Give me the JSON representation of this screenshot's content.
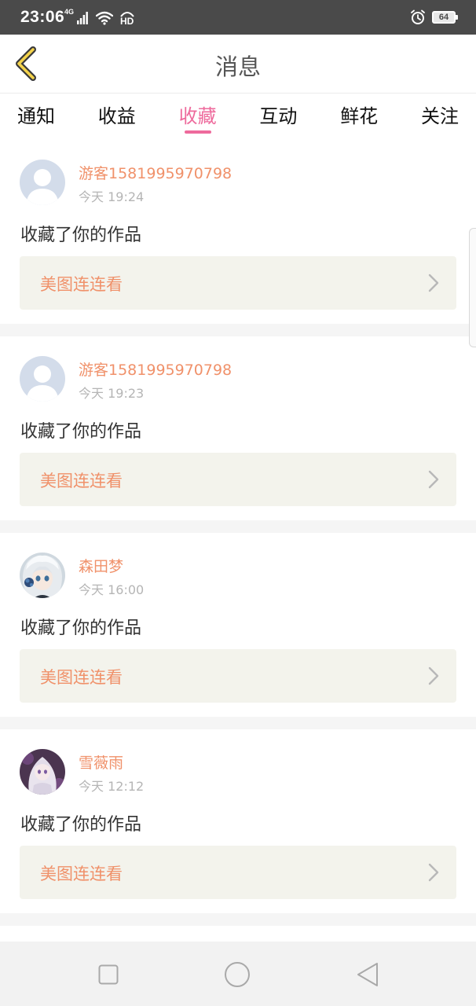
{
  "status_bar": {
    "time": "23:06",
    "network": "4G",
    "hd_label": "HD",
    "battery": "64"
  },
  "header": {
    "title": "消息",
    "back_icon": "chevron-left-icon"
  },
  "tabs": [
    {
      "label": "通知",
      "active": false
    },
    {
      "label": "收益",
      "active": false
    },
    {
      "label": "收藏",
      "active": true
    },
    {
      "label": "互动",
      "active": false
    },
    {
      "label": "鲜花",
      "active": false
    },
    {
      "label": "关注",
      "active": false
    }
  ],
  "notifications": [
    {
      "user": "游客1581995970798",
      "time": "今天 19:24",
      "action": "收藏了你的作品",
      "work": "美图连连看",
      "avatar": "default-avatar"
    },
    {
      "user": "游客1581995970798",
      "time": "今天 19:23",
      "action": "收藏了你的作品",
      "work": "美图连连看",
      "avatar": "default-avatar"
    },
    {
      "user": "森田梦",
      "time": "今天 16:00",
      "action": "收藏了你的作品",
      "work": "美图连连看",
      "avatar": "anime-avatar-blue"
    },
    {
      "user": "雪薇雨",
      "time": "今天 12:12",
      "action": "收藏了你的作品",
      "work": "美图连连看",
      "avatar": "anime-avatar-purple"
    }
  ],
  "colors": {
    "accent_pink": "#ee6a9c",
    "username_orange": "#f0916a",
    "card_bg": "#f3f3ec",
    "status_bar": "#4a4a4a"
  }
}
